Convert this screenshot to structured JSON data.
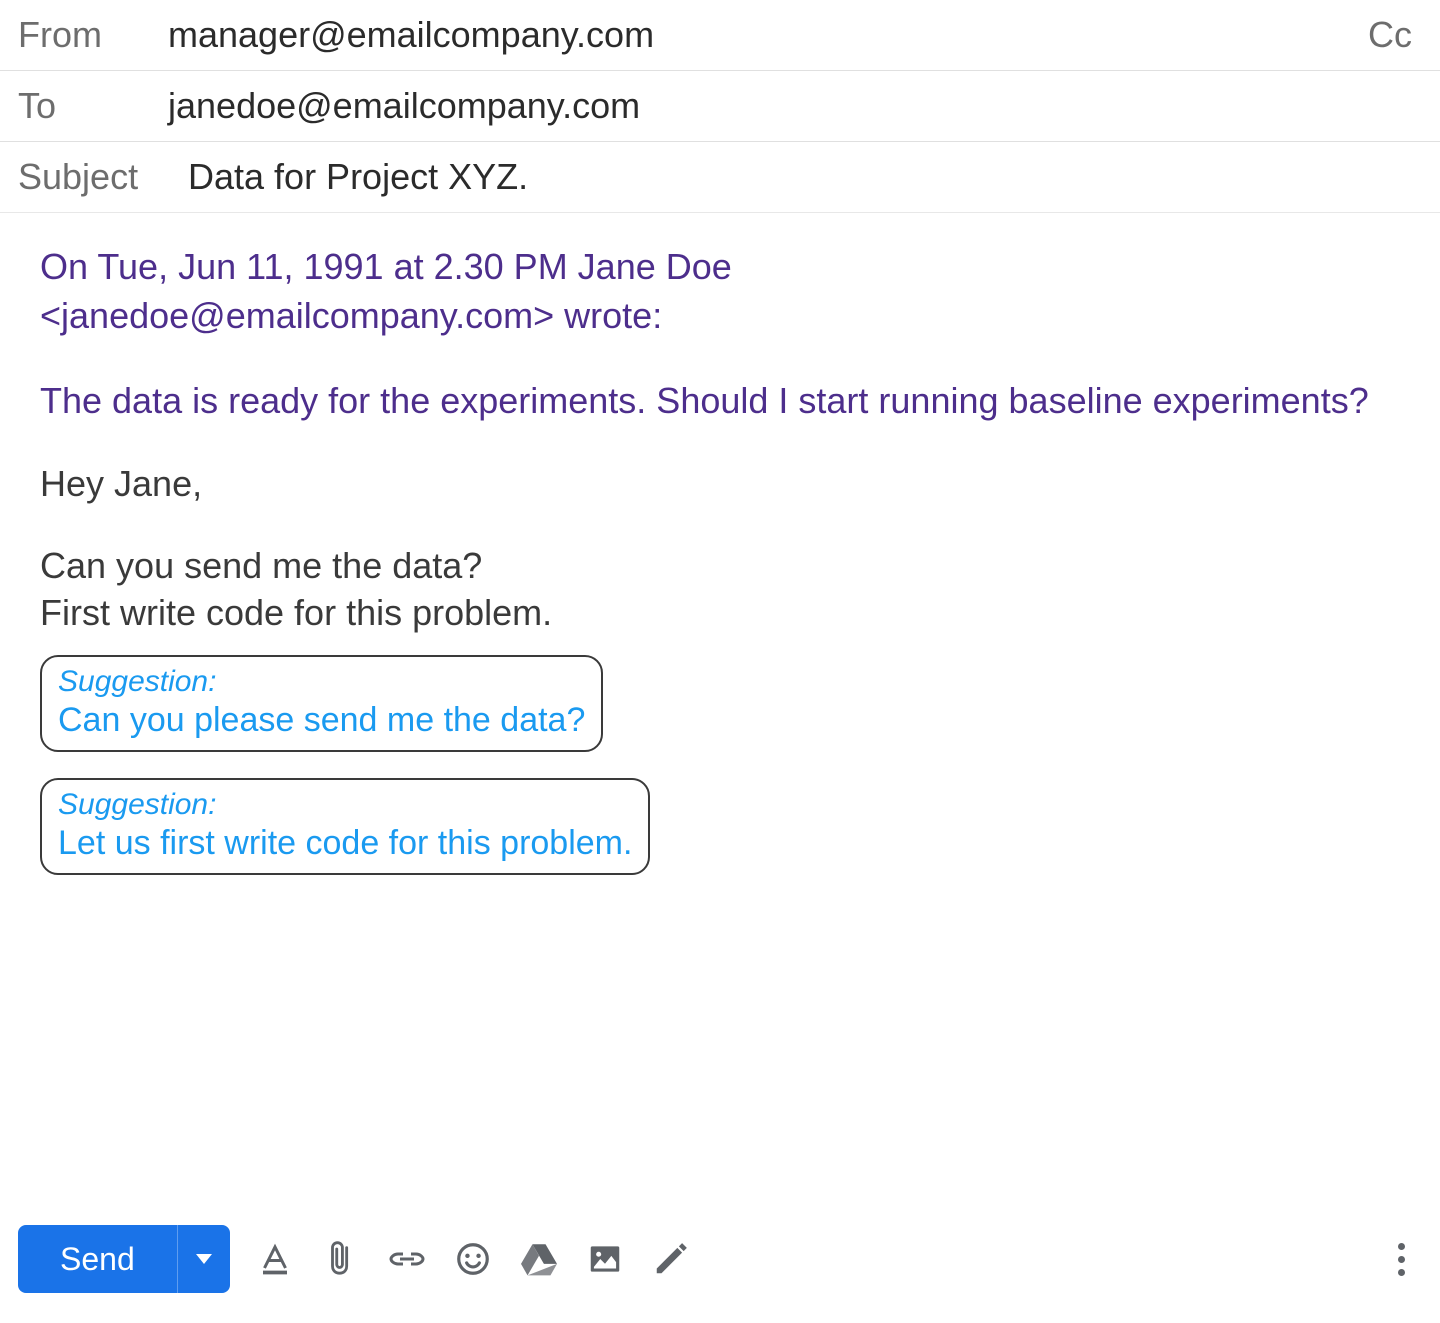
{
  "header": {
    "from_label": "From",
    "from_value": "manager@emailcompany.com",
    "to_label": "To",
    "to_value": "janedoe@emailcompany.com",
    "cc_label": "Cc",
    "subject_label": "Subject",
    "subject_value": "Data for Project XYZ."
  },
  "body": {
    "quoted_header_line1": "On Tue, Jun 11, 1991 at 2.30 PM Jane Doe",
    "quoted_header_line2": "<janedoe@emailcompany.com> wrote:",
    "quoted_content": "The data is ready for the experiments. Should I start running baseline experiments?",
    "reply_greeting": "Hey Jane,",
    "reply_line1": "Can you send me the data?",
    "reply_line2": "First write code for this problem."
  },
  "suggestions": [
    {
      "label": "Suggestion:",
      "text": "Can you please send me the data?"
    },
    {
      "label": "Suggestion:",
      "text": "Let us first write code for this problem."
    }
  ],
  "toolbar": {
    "send_label": "Send"
  }
}
